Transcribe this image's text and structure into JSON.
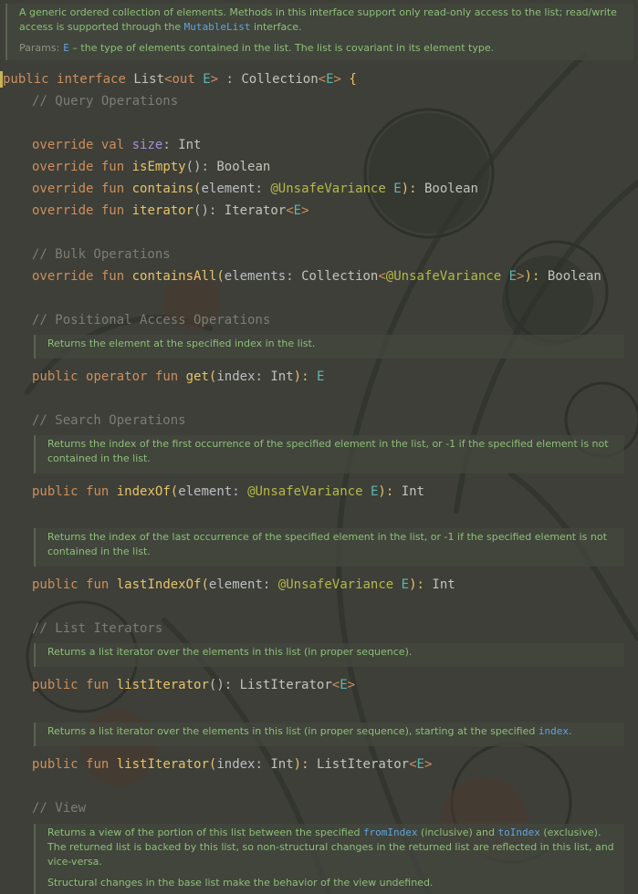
{
  "header_doc": {
    "text_a": "A generic ordered collection of elements. Methods in this interface support only read-only access to the list; read/write access is supported through the ",
    "link": "MutableList",
    "text_b": " interface.",
    "params_label": "Params:",
    "param_name": "E",
    "param_desc": " – the type of elements contained in the list. The list is covariant in its element type."
  },
  "code": {
    "decl": {
      "kw1": "public",
      "kw2": "interface",
      "name": "List",
      "lt": "<",
      "out": "out",
      "e": "E",
      "gt": ">",
      "colon": " : ",
      "super": "Collection",
      "lt2": "<",
      "e2": "E",
      "gt2": ">",
      "brace": " {"
    },
    "query_comment": "// Query Operations",
    "size": {
      "kw1": "override",
      "kw2": "val",
      "name": "size",
      "colon": ": ",
      "type": "Int"
    },
    "isEmpty": {
      "kw1": "override",
      "kw2": "fun",
      "name": "isEmpty",
      "paren": "(): ",
      "type": "Boolean"
    },
    "contains": {
      "kw1": "override",
      "kw2": "fun",
      "name": "contains",
      "open": "(",
      "param": "element",
      "colon": ": ",
      "ann": "@UnsafeVariance",
      "e": "E",
      "close": "): ",
      "type": "Boolean"
    },
    "iterator": {
      "kw1": "override",
      "kw2": "fun",
      "name": "iterator",
      "paren": "(): ",
      "type": "Iterator",
      "lt": "<",
      "e": "E",
      "gt": ">"
    },
    "bulk_comment": "// Bulk Operations",
    "containsAll": {
      "kw1": "override",
      "kw2": "fun",
      "name": "containsAll",
      "open": "(",
      "param": "elements",
      "colon": ": ",
      "type1": "Collection",
      "lt": "<",
      "ann": "@UnsafeVariance",
      "e": "E",
      "gt": ">",
      "close": "): ",
      "type": "Boolean"
    },
    "positional_comment": "// Positional Access Operations",
    "get_doc": "Returns the element at the specified index in the list.",
    "get": {
      "kw1": "public",
      "kw2": "operator",
      "kw3": "fun",
      "name": "get",
      "open": "(",
      "param": "index",
      "colon": ": ",
      "ptype": "Int",
      "close": "): ",
      "e": "E"
    },
    "search_comment": "// Search Operations",
    "indexOf_doc": "Returns the index of the first occurrence of the specified element in the list, or -1 if the specified element is not contained in the list.",
    "indexOf": {
      "kw1": "public",
      "kw2": "fun",
      "name": "indexOf",
      "open": "(",
      "param": "element",
      "colon": ": ",
      "ann": "@UnsafeVariance",
      "e": "E",
      "close": "): ",
      "type": "Int"
    },
    "lastIndexOf_doc": "Returns the index of the last occurrence of the specified element in the list, or -1 if the specified element is not contained in the list.",
    "lastIndexOf": {
      "kw1": "public",
      "kw2": "fun",
      "name": "lastIndexOf",
      "open": "(",
      "param": "element",
      "colon": ": ",
      "ann": "@UnsafeVariance",
      "e": "E",
      "close": "): ",
      "type": "Int"
    },
    "iterators_comment": "// List Iterators",
    "listIterator_doc": "Returns a list iterator over the elements in this list (in proper sequence).",
    "listIterator": {
      "kw1": "public",
      "kw2": "fun",
      "name": "listIterator",
      "paren": "(): ",
      "type": "ListIterator",
      "lt": "<",
      "e": "E",
      "gt": ">"
    },
    "listIterator2_doc_a": "Returns a list iterator over the elements in this list (in proper sequence), starting at the specified ",
    "listIterator2_doc_code": "index",
    "listIterator2_doc_b": ".",
    "listIterator2": {
      "kw1": "public",
      "kw2": "fun",
      "name": "listIterator",
      "open": "(",
      "param": "index",
      "colon": ": ",
      "ptype": "Int",
      "close": "): ",
      "type": "ListIterator",
      "lt": "<",
      "e": "E",
      "gt": ">"
    },
    "view_comment": "// View",
    "view_doc_a": "Returns a view of the portion of this list between the specified ",
    "view_doc_code1": "fromIndex",
    "view_doc_b": " (inclusive) and ",
    "view_doc_code2": "toIndex",
    "view_doc_c": " (exclusive). The returned list is backed by this list, so non-structural changes in the returned list are reflected in this list, and vice-versa.",
    "view_doc_p2": "Structural changes in the base list make the behavior of the view undefined."
  },
  "colors": {
    "background": "#3d3f38",
    "keyword": "#cf8e5d",
    "function": "#e7c36a",
    "comment": "#7b7e75",
    "doc_text": "#8fbf78",
    "doc_code": "#62a3dd",
    "generic": "#5fb7ad",
    "annotation": "#b6b84a",
    "property": "#a98fd6"
  }
}
